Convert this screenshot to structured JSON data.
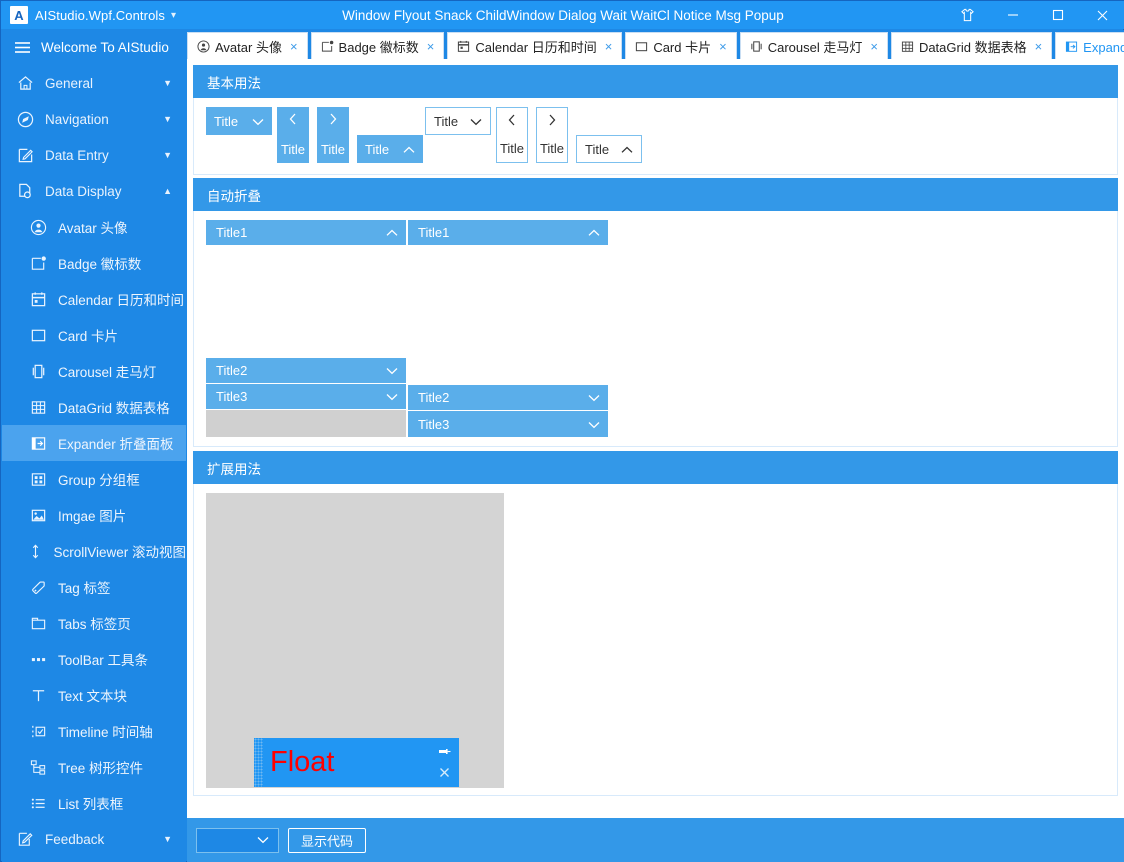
{
  "titlebar": {
    "logo": "A",
    "app_name": "AIStudio.Wpf.Controls",
    "caret_icon": "chevron-down-icon",
    "menu_text": "Window Flyout Snack ChildWindow Dialog Wait WaitCl Notice Msg Popup",
    "theme_icon": "shirt-icon",
    "minimize_icon": "minimize-icon",
    "maximize_icon": "maximize-icon",
    "close_icon": "close-icon"
  },
  "sidebar": {
    "header": {
      "burger_icon": "hamburger-icon",
      "label": "Welcome To AIStudio"
    },
    "groups": [
      {
        "label": "General",
        "icon": "home-icon",
        "arrow": "▼",
        "expanded": false
      },
      {
        "label": "Navigation",
        "icon": "navigation-icon",
        "arrow": "▼",
        "expanded": false
      },
      {
        "label": "Data Entry",
        "icon": "edit-icon",
        "arrow": "▼",
        "expanded": false
      },
      {
        "label": "Data Display",
        "icon": "datadisplay-icon",
        "arrow": "▲",
        "expanded": true
      }
    ],
    "items": [
      {
        "label": "Avatar 头像",
        "icon": "avatar-icon",
        "selected": false
      },
      {
        "label": "Badge 徽标数",
        "icon": "badge-icon",
        "selected": false
      },
      {
        "label": "Calendar 日历和时间",
        "icon": "calendar-icon",
        "selected": false
      },
      {
        "label": "Card 卡片",
        "icon": "card-icon",
        "selected": false
      },
      {
        "label": "Carousel 走马灯",
        "icon": "carousel-icon",
        "selected": false
      },
      {
        "label": "DataGrid 数据表格",
        "icon": "datagrid-icon",
        "selected": false
      },
      {
        "label": "Expander 折叠面板",
        "icon": "expander-icon",
        "selected": true
      },
      {
        "label": "Group 分组框",
        "icon": "group-icon",
        "selected": false
      },
      {
        "label": "Imgae 图片",
        "icon": "image-icon",
        "selected": false
      },
      {
        "label": "ScrollViewer 滚动视图",
        "icon": "scrollviewer-icon",
        "selected": false
      },
      {
        "label": "Tag 标签",
        "icon": "tag-icon",
        "selected": false
      },
      {
        "label": "Tabs 标签页",
        "icon": "tabs-icon",
        "selected": false
      },
      {
        "label": "ToolBar 工具条",
        "icon": "toolbar-icon",
        "selected": false
      },
      {
        "label": "Text 文本块",
        "icon": "text-icon",
        "selected": false
      },
      {
        "label": "Timeline 时间轴",
        "icon": "timeline-icon",
        "selected": false
      },
      {
        "label": "Tree 树形控件",
        "icon": "tree-icon",
        "selected": false
      },
      {
        "label": "List 列表框",
        "icon": "list-icon",
        "selected": false
      }
    ],
    "footer_group": {
      "label": "Feedback",
      "icon": "feedback-icon",
      "arrow": "▼"
    }
  },
  "tabs": [
    {
      "label": "Avatar 头像",
      "icon": "avatar-icon",
      "close": "×",
      "active": false
    },
    {
      "label": "Badge 徽标数",
      "icon": "badge-icon",
      "close": "×",
      "active": false
    },
    {
      "label": "Calendar 日历和时间",
      "icon": "calendar-icon",
      "close": "×",
      "active": false
    },
    {
      "label": "Card 卡片",
      "icon": "card-icon",
      "close": "×",
      "active": false
    },
    {
      "label": "Carousel 走马灯",
      "icon": "carousel-icon",
      "close": "×",
      "active": false
    },
    {
      "label": "DataGrid 数据表格",
      "icon": "datagrid-icon",
      "close": "×",
      "active": false
    },
    {
      "label": "Expander 折",
      "icon": "expander-icon",
      "close": "",
      "active": true,
      "overflow_chevron": "⌄"
    }
  ],
  "sections": {
    "basic": {
      "title": "基本用法"
    },
    "autofold": {
      "title": "自动折叠"
    },
    "extended": {
      "title": "扩展用法"
    }
  },
  "basic_expanders": [
    {
      "id": "filled-down",
      "title": "Title",
      "chevron": "⌄",
      "direction": "down",
      "style": "filled"
    },
    {
      "id": "filled-left",
      "title": "Title",
      "chevron": "‹",
      "direction": "left",
      "style": "filled"
    },
    {
      "id": "filled-right",
      "title": "Title",
      "chevron": "›",
      "direction": "right",
      "style": "filled"
    },
    {
      "id": "filled-up",
      "title": "Title",
      "chevron": "˄",
      "direction": "up",
      "style": "filled"
    },
    {
      "id": "outline-down",
      "title": "Title",
      "chevron": "⌄",
      "direction": "down",
      "style": "outline"
    },
    {
      "id": "outline-left",
      "title": "Title",
      "chevron": "‹",
      "direction": "left",
      "style": "outline"
    },
    {
      "id": "outline-right",
      "title": "Title",
      "chevron": "›",
      "direction": "right",
      "style": "outline"
    },
    {
      "id": "outline-up",
      "title": "Title",
      "chevron": "˄",
      "direction": "up",
      "style": "outline"
    }
  ],
  "accordion_left": [
    {
      "label": "Title1",
      "chevron": "˄",
      "expanded": true
    },
    {
      "label": "Title2",
      "chevron": "⌄",
      "expanded": false
    },
    {
      "label": "Title3",
      "chevron": "⌄",
      "expanded": false
    }
  ],
  "accordion_right": [
    {
      "label": "Title1",
      "chevron": "˄",
      "expanded": true
    },
    {
      "label": "Title2",
      "chevron": "⌄",
      "expanded": false
    },
    {
      "label": "Title3",
      "chevron": "⌄",
      "expanded": false
    }
  ],
  "float_panel": {
    "title": "Float",
    "pin_icon": "pin-icon",
    "close_icon": "close-icon"
  },
  "bottombar": {
    "combo_value": "",
    "combo_chevron": "⌄",
    "show_code_label": "显示代码"
  },
  "colors": {
    "accent": "#2196f3",
    "sidebar": "#1e88e5",
    "section_header": "#3398e8",
    "expander_fill": "#5aaeea",
    "expander_border": "#7cc0ee",
    "selected_item": "#4ba3ee",
    "float_title": "#ff0000",
    "grey_box": "#d4d4d4"
  }
}
